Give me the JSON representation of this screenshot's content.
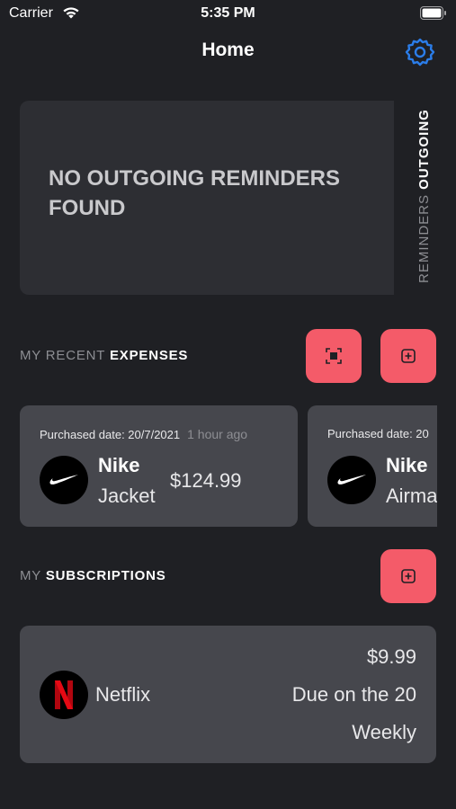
{
  "status_bar": {
    "carrier": "Carrier",
    "time": "5:35 PM"
  },
  "nav": {
    "title": "Home",
    "settings_icon": "gear-icon"
  },
  "reminders": {
    "empty_message": "NO OUTGOING REMINDERS FOUND",
    "tab_muted": "REMINDERS",
    "tab_active": "OUTGOING"
  },
  "expenses_section": {
    "label_prefix": "MY RECENT",
    "label_main": "EXPENSES",
    "scan_icon": "scan-icon",
    "add_icon": "plus-square-icon",
    "items": [
      {
        "purchase_label": "Purchased date: 20/7/2021",
        "ago": "1 hour ago",
        "brand": "Nike",
        "product": "Jacket",
        "price": "$124.99",
        "logo": "nike-swoosh-icon"
      },
      {
        "purchase_label": "Purchased date: 20",
        "brand": "Nike",
        "product": "Airma",
        "logo": "nike-swoosh-icon"
      }
    ]
  },
  "subscriptions_section": {
    "label_prefix": "MY",
    "label_main": "SUBSCRIPTIONS",
    "add_icon": "plus-square-icon",
    "items": [
      {
        "name": "Netflix",
        "price": "$9.99",
        "due": "Due on the 20",
        "frequency": "Weekly",
        "logo": "netflix-n-icon"
      }
    ]
  },
  "colors": {
    "background": "#1f2024",
    "card": "#46474d",
    "reminder_card": "#2d2e33",
    "accent": "#f45b69",
    "settings_blue": "#2b7de9"
  }
}
